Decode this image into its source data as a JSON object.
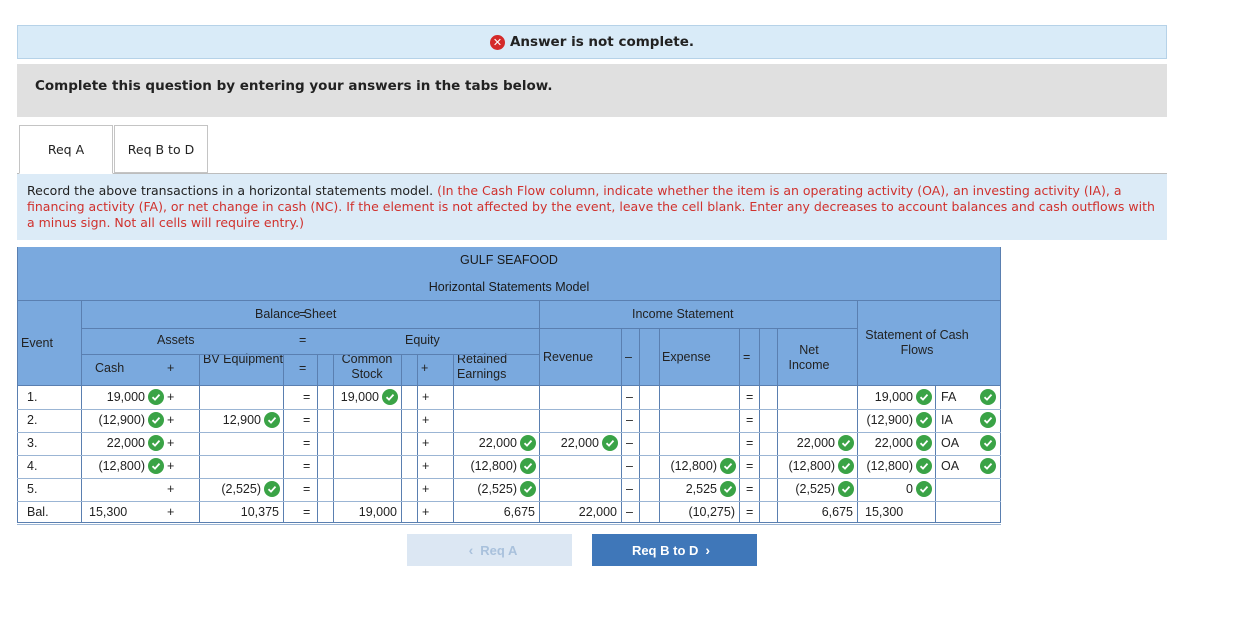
{
  "alert": {
    "icon": "error-x-icon",
    "text": "Answer is not complete."
  },
  "instruction": "Complete this question by entering your answers in the tabs below.",
  "tabs": [
    {
      "label": "Req A",
      "active": true
    },
    {
      "label": "Req B to D",
      "active": false
    }
  ],
  "description": {
    "plain": "Record the above transactions in a horizontal statements model. ",
    "red": "(In the Cash Flow column, indicate whether the item is an operating activity (OA), an investing activity (IA), a financing activity (FA), or net change in cash (NC). If the element is not affected by the event, leave the cell blank. Enter any decreases to account balances and cash outflows with a minus sign. Not all cells will require entry.)"
  },
  "table": {
    "company": "GULF SEAFOOD",
    "subtitle": "Horizontal Statements Model",
    "balance_sheet": "Balance Sheet",
    "income_statement": "Income Statement",
    "cash_flows": "Statement of Cash Flows",
    "event": "Event",
    "assets": "Assets",
    "equity": "Equity",
    "cash": "Cash",
    "plus": "+",
    "equals": "=",
    "minus": "–",
    "bv_equipment": "BV Equipment",
    "common_stock": "Common Stock",
    "retained_earnings": "Retained Earnings",
    "revenue": "Revenue",
    "expense": "Expense",
    "net_income": "Net Income",
    "rows": [
      {
        "event": "1.",
        "cash": "19,000",
        "bv": "",
        "cs": "19,000",
        "re": "",
        "rev": "",
        "exp": "",
        "ni": "",
        "cf": "19,000",
        "cf_type": "FA"
      },
      {
        "event": "2.",
        "cash": "(12,900)",
        "bv": "12,900",
        "cs": "",
        "re": "",
        "rev": "",
        "exp": "",
        "ni": "",
        "cf": "(12,900)",
        "cf_type": "IA"
      },
      {
        "event": "3.",
        "cash": "22,000",
        "bv": "",
        "cs": "",
        "re": "22,000",
        "rev": "22,000",
        "exp": "",
        "ni": "22,000",
        "cf": "22,000",
        "cf_type": "OA"
      },
      {
        "event": "4.",
        "cash": "(12,800)",
        "bv": "",
        "cs": "",
        "re": "(12,800)",
        "rev": "",
        "exp": "(12,800)",
        "ni": "(12,800)",
        "cf": "(12,800)",
        "cf_type": "OA"
      },
      {
        "event": "5.",
        "cash": "",
        "bv": "(2,525)",
        "cs": "",
        "re": "(2,525)",
        "rev": "",
        "exp": "2,525",
        "ni": "(2,525)",
        "cf": "0",
        "cf_type": ""
      },
      {
        "event": "Bal.",
        "cash": "15,300",
        "bv": "10,375",
        "cs": "19,000",
        "re": "6,675",
        "rev": "22,000",
        "exp": "(10,275)",
        "ni": "6,675",
        "cf": "15,300",
        "cf_type": ""
      }
    ]
  },
  "buttons": {
    "prev": "Req A",
    "next": "Req B to D"
  },
  "colors": {
    "header_blue": "#7aa9de",
    "check_green": "#3aa346",
    "next_button": "#3f77b9",
    "error_red": "#d42a2a"
  }
}
